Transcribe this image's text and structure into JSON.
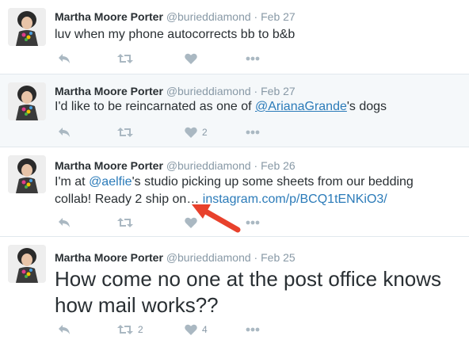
{
  "colors": {
    "name": "#292f33",
    "meta": "#8899a6",
    "link": "#2b7bb9",
    "action_icon": "#aab8c2",
    "divider": "#e1e8ed",
    "hover_bg": "#f5f8fa",
    "annotation_arrow": "#e8412c"
  },
  "tweets": [
    {
      "fullname": "Martha Moore Porter",
      "username": "@burieddiamond",
      "separator": "·",
      "time": "Feb 27",
      "text": "luv when my phone autocorrects bb to b&b",
      "retweet_count": "",
      "like_count": ""
    },
    {
      "fullname": "Martha Moore Porter",
      "username": "@burieddiamond",
      "separator": "·",
      "time": "Feb 27",
      "text_before": "I'd like to be reincarnated as one of ",
      "mention": "@ArianaGrande",
      "text_after": "'s dogs",
      "retweet_count": "",
      "like_count": "2"
    },
    {
      "fullname": "Martha Moore Porter",
      "username": "@burieddiamond",
      "separator": "·",
      "time": "Feb 26",
      "text_before": "I'm at ",
      "mention": "@aelfie",
      "text_middle": "'s studio picking up some sheets from our bedding collab! Ready 2 ship on… ",
      "url": "instagram.com/p/BCQ1tENKiO3/",
      "retweet_count": "",
      "like_count": ""
    },
    {
      "fullname": "Martha Moore Porter",
      "username": "@burieddiamond",
      "separator": "·",
      "time": "Feb 25",
      "text": "How come no one at the post office knows how mail works??",
      "retweet_count": "2",
      "like_count": "4"
    }
  ],
  "icons": {
    "reply": "reply-arrow-icon",
    "retweet": "retweet-icon",
    "like": "heart-icon",
    "more": "more-dots-icon",
    "annotation": "red-arrow-icon"
  }
}
